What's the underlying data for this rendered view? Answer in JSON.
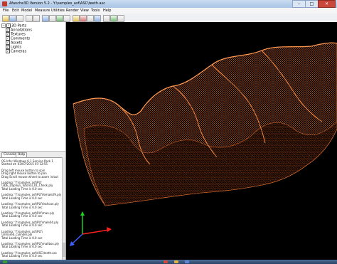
{
  "window": {
    "title": "Afanche3D Version 5.2 - Y:\\samples_asf\\ASC\\teeth.asc",
    "controls": {
      "minimize": "–",
      "maximize": "□",
      "close": "✕"
    }
  },
  "menu": [
    "File",
    "Edit",
    "Model",
    "Measure",
    "Utilities",
    "Render",
    "View",
    "Tools",
    "Help"
  ],
  "tree": {
    "root": "3D Parts",
    "items": [
      "Annotations",
      "Textures",
      "Comments",
      "Assets",
      "Lights",
      "Cameras"
    ]
  },
  "tabs": [
    "Console",
    "Help"
  ],
  "console": [
    "OS Info: Windows 6.1 Service Pack 1",
    "Started at: 03/07/2015 07:12:55",
    "",
    "Drag left mouse button to spin",
    "Drag right mouse button to pan",
    "Drag Scroll mouse wheel to zoom in/out",
    "",
    "Loading: 'Y:\\samples_asf\\PLY",
    "\\3DE_Daphyn_Tutorial_01_Check.ply",
    "Total Loading Time is 0.0 sec",
    "",
    "Loading: 'Y:\\samples_asf\\PLY\\female29.ply",
    "Total Loading Time is 0.0 sec",
    "",
    "Loading: 'Y:\\samples_asf\\PLY\\fashcan.ply",
    "Total Loading Time is 0.0 sec",
    "",
    "Loading: 'Y:\\samples_asf\\PLY\\man.ply",
    "Total Loading Time is 0.0 sec",
    "",
    "Loading: 'Y:\\samples_asf\\PLY\\male04.ply",
    "Total Loading Time is 0.0 sec",
    "",
    "Loading: 'Y:\\samples_asf\\PLY\\",
    "\\armored_cylinder.ply",
    "Total Loading Time is 0.0 sec",
    "",
    "Loading: 'Y:\\samples_asf\\PLY\\mailbox.ply",
    "Total Loading Time is 0.0 sec",
    "",
    "Loading: 'Y:\\samples_asf\\ASC\\teeth.asc",
    "Total Loading Time is 0.0 sec"
  ],
  "colors": {
    "pointcloud": "#d9692a",
    "axis_x": "#ff2020",
    "axis_y": "#20d020",
    "axis_z": "#4060ff",
    "viewport_bg": "#000000"
  },
  "icons": [
    "open-icon",
    "save-icon",
    "print-icon",
    "undo-icon",
    "redo-icon",
    "zoom-icon",
    "pan-icon",
    "rotate-icon",
    "fit-icon",
    "light-icon",
    "texture-icon",
    "wireframe-icon",
    "points-icon",
    "measure-icon",
    "camera-icon",
    "settings-icon"
  ]
}
